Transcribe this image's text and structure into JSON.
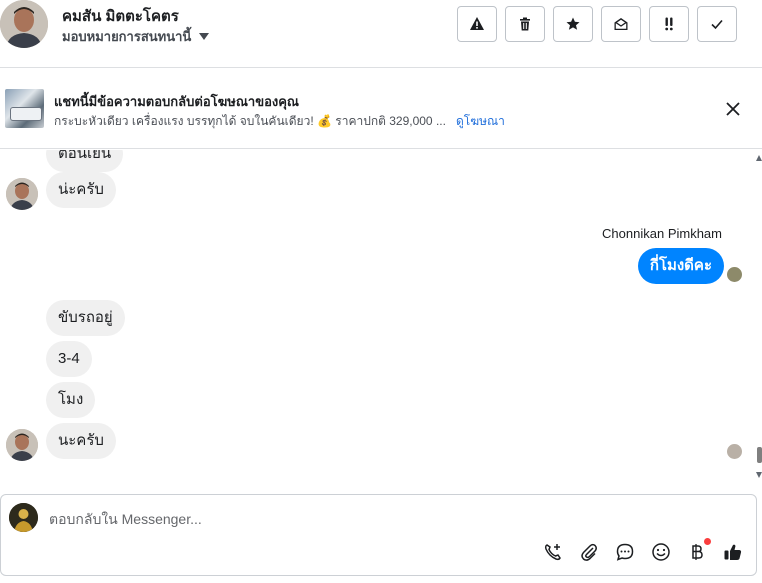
{
  "header": {
    "contact_name": "คมสัน มิตตะโคตร",
    "assign_label": "มอบหมายการสนทนานี้",
    "actions": [
      {
        "name": "report-button",
        "icon": "warning-icon"
      },
      {
        "name": "delete-button",
        "icon": "trash-icon"
      },
      {
        "name": "star-button",
        "icon": "star-icon"
      },
      {
        "name": "mark-unread-button",
        "icon": "envelope-open-icon"
      },
      {
        "name": "mark-important-button",
        "icon": "double-exclamation-icon"
      },
      {
        "name": "mark-done-button",
        "icon": "checkmark-icon"
      }
    ]
  },
  "ad_banner": {
    "title": "แชทนี้มีข้อความตอบกลับต่อโฆษณาของคุณ",
    "description": "กระบะหัวเดียว เครื่องแรง บรรทุกได้ จบในคันเดียว! 💰 ราคาปกติ 329,000 ...",
    "link_label": "ดูโฆษณา"
  },
  "messages": {
    "incoming_cut": "ตอนเย็น",
    "incoming_1": "น่ะครับ",
    "sender_name": "Chonnikan Pimkham",
    "outgoing_1": "กี่โมงดีคะ",
    "incoming_2": "ขับรถอยู่",
    "incoming_3": "3-4",
    "incoming_4": "โมง",
    "incoming_5": "นะครับ"
  },
  "composer": {
    "placeholder": "ตอบกลับใน Messenger...",
    "tools": [
      "call-add-icon",
      "paperclip-icon",
      "chat-bubble-icon",
      "smiley-icon",
      "baht-icon",
      "thumbs-up-icon"
    ]
  },
  "colors": {
    "accent": "#0084ff",
    "link": "#216fdb",
    "incoming_bubble": "#f0f0f0",
    "notification_dot": "#fa3e3e"
  }
}
